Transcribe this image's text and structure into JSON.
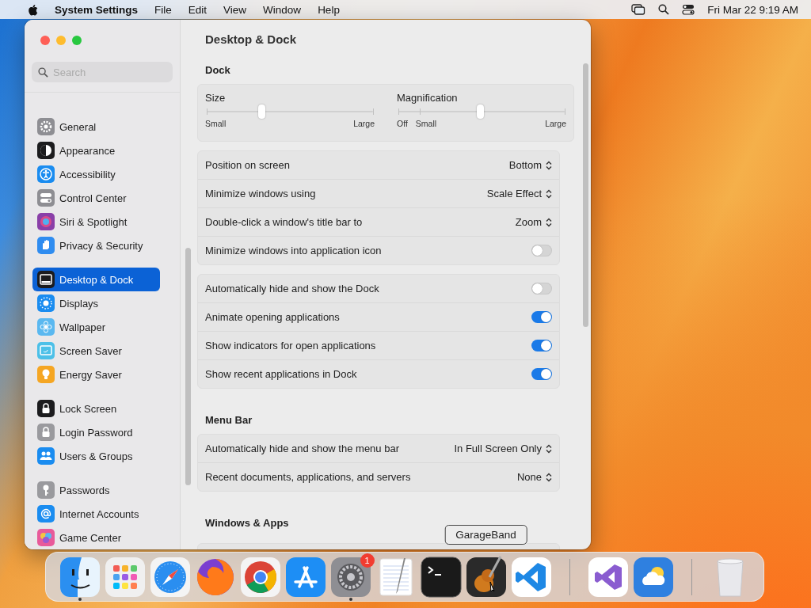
{
  "menu_bar": {
    "app_name": "System Settings",
    "menus": [
      "File",
      "Edit",
      "View",
      "Window",
      "Help"
    ],
    "clock": "Fri Mar 22  9:19 AM"
  },
  "window": {
    "title": "Desktop & Dock"
  },
  "sidebar": {
    "search": {
      "placeholder": "Search"
    },
    "groups": [
      [
        {
          "label": "General",
          "selected": false,
          "color": "#8e8e93"
        },
        {
          "label": "Appearance",
          "selected": false,
          "color": "#1c1c1e"
        },
        {
          "label": "Accessibility",
          "selected": false,
          "color": "#1a8cf0"
        },
        {
          "label": "Control Center",
          "selected": false,
          "color": "#8e8e93"
        },
        {
          "label": "Siri & Spotlight",
          "selected": false,
          "color": "#8a3fa8"
        },
        {
          "label": "Privacy & Security",
          "selected": false,
          "color": "#2f8cf0"
        }
      ],
      [
        {
          "label": "Desktop & Dock",
          "selected": true,
          "color": "#1c1c1e"
        },
        {
          "label": "Displays",
          "selected": false,
          "color": "#1a8cf0"
        },
        {
          "label": "Wallpaper",
          "selected": false,
          "color": "#5ab8f0"
        },
        {
          "label": "Screen Saver",
          "selected": false,
          "color": "#4cc0e8"
        },
        {
          "label": "Energy Saver",
          "selected": false,
          "color": "#f5a623"
        }
      ],
      [
        {
          "label": "Lock Screen",
          "selected": false,
          "color": "#1c1c1e"
        },
        {
          "label": "Login Password",
          "selected": false,
          "color": "#9a9a9e"
        },
        {
          "label": "Users & Groups",
          "selected": false,
          "color": "#1a8cf0"
        }
      ],
      [
        {
          "label": "Passwords",
          "selected": false,
          "color": "#9a9a9e"
        },
        {
          "label": "Internet Accounts",
          "selected": false,
          "color": "#1a8cf0"
        },
        {
          "label": "Game Center",
          "selected": false,
          "color": "#e85a9a"
        }
      ]
    ]
  },
  "sections": [
    {
      "heading": "Dock",
      "groups": [
        {
          "kind": "sliders",
          "sliders": [
            {
              "label": "Size",
              "level": 0.33,
              "marks": [
                "Small",
                "Large"
              ]
            },
            {
              "label": "Magnification",
              "level": 0.49,
              "marks": [
                "Off",
                "Small",
                "Large"
              ]
            }
          ]
        },
        {
          "kind": "rows",
          "rows": [
            {
              "kind": "select",
              "label": "Position on screen",
              "value": "Bottom"
            },
            {
              "kind": "select",
              "label": "Minimize windows using",
              "value": "Scale Effect"
            },
            {
              "kind": "select",
              "label": "Double-click a window's title bar to",
              "value": "Zoom"
            },
            {
              "kind": "toggle",
              "label": "Minimize windows into application icon",
              "on": false
            }
          ]
        },
        {
          "kind": "rows",
          "rows": [
            {
              "kind": "toggle",
              "label": "Automatically hide and show the Dock",
              "on": false
            },
            {
              "kind": "toggle",
              "label": "Animate opening applications",
              "on": true
            },
            {
              "kind": "toggle",
              "label": "Show indicators for open applications",
              "on": true
            },
            {
              "kind": "toggle",
              "label": "Show recent applications in Dock",
              "on": true
            }
          ]
        }
      ]
    },
    {
      "heading": "Menu Bar",
      "groups": [
        {
          "kind": "rows",
          "rows": [
            {
              "kind": "select",
              "label": "Automatically hide and show the menu bar",
              "value": "In Full Screen Only"
            },
            {
              "kind": "select",
              "label": "Recent documents, applications, and servers",
              "value": "None"
            }
          ]
        }
      ]
    },
    {
      "heading": "Windows & Apps"
    }
  ],
  "dock": {
    "sections": [
      [
        {
          "running": true
        },
        {
          "running": false
        },
        {
          "running": false
        },
        {
          "running": false
        },
        {
          "running": false
        },
        {
          "running": false
        },
        {
          "running": true,
          "badge": "1"
        },
        {
          "running": false
        },
        {
          "running": false
        },
        {
          "running": false,
          "tooltip": "GarageBand"
        },
        {
          "running": false
        }
      ],
      [
        {
          "running": false
        },
        {
          "running": false
        }
      ],
      [
        {
          "running": false
        }
      ]
    ]
  }
}
